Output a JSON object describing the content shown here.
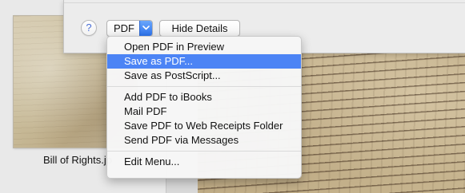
{
  "toolbar": {
    "help_label": "?",
    "pdf_label": "PDF",
    "hide_details_label": "Hide Details"
  },
  "thumbnail": {
    "filename": "Bill of Rights.jp"
  },
  "menu": {
    "items": [
      {
        "label": "Open PDF in Preview",
        "selected": false
      },
      {
        "label": "Save as PDF...",
        "selected": true
      },
      {
        "label": "Save as PostScript...",
        "selected": false
      },
      {
        "label": "Add PDF to iBooks",
        "selected": false
      },
      {
        "label": "Mail PDF",
        "selected": false
      },
      {
        "label": "Save PDF to Web Receipts Folder",
        "selected": false
      },
      {
        "label": "Send PDF via Messages",
        "selected": false
      },
      {
        "label": "Edit Menu...",
        "selected": false
      }
    ]
  },
  "colors": {
    "selection": "#4c84f5",
    "accent_arrow": "#2e74ee",
    "help_glyph": "#4a6fd6"
  }
}
